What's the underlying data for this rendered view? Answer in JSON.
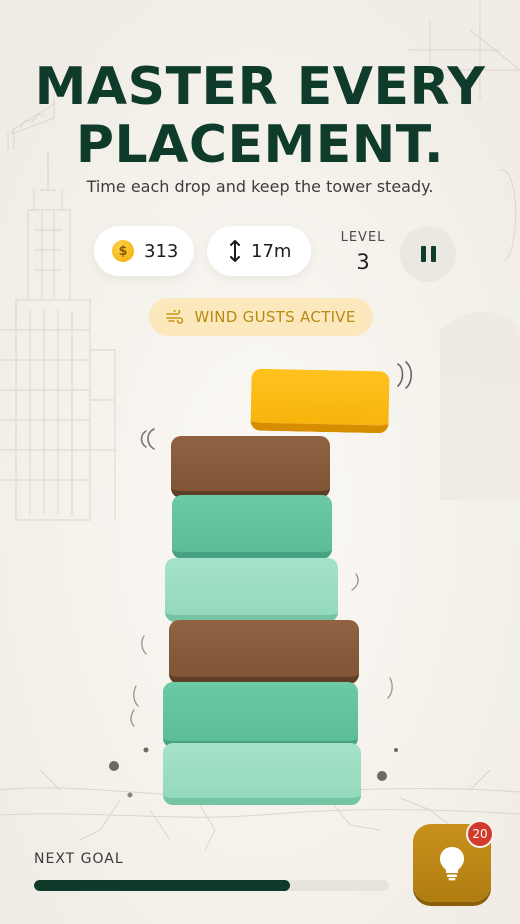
{
  "headline": {
    "line1": "MASTER EVERY",
    "line2": "PLACEMENT."
  },
  "subtitle": "Time each drop and keep the tower steady.",
  "stats": {
    "coins": "313",
    "height": "17m",
    "level_label": "LEVEL",
    "level_value": "3"
  },
  "wind": {
    "label": "WIND GUSTS ACTIVE"
  },
  "tower": {
    "falling_block": {
      "color": "yellow"
    },
    "stack": [
      "brown",
      "teal",
      "mint",
      "brown",
      "teal",
      "mint"
    ]
  },
  "goal": {
    "label": "NEXT GOAL",
    "progress": 0.72
  },
  "hint": {
    "badge_count": "20"
  },
  "colors": {
    "brand_dark": "#0f3b2b",
    "mint": "#a5e3c8",
    "teal": "#6ccaa6",
    "brown": "#8f6242",
    "yellow": "#ffc21f",
    "hint": "#c8911a",
    "badge": "#d23a2c"
  },
  "icons": {
    "coin": "coin-icon",
    "height": "vertical-arrow-icon",
    "pause": "pause-icon",
    "wind": "wind-icon",
    "hint": "lightbulb-icon"
  }
}
